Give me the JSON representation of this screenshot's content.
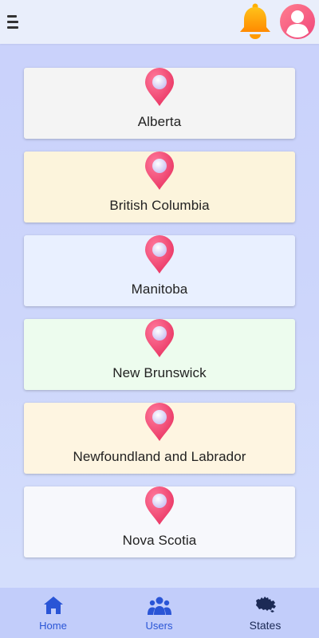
{
  "colors": {
    "pin": "#f0467a",
    "accent": "#2a55d6",
    "card_backgrounds": [
      "#f4f4f4",
      "#fcf4dc",
      "#e9f0ff",
      "#edfcee",
      "#fef5e1",
      "#f7f8fc"
    ]
  },
  "header": {
    "menu_icon": "hamburger-menu-icon",
    "notification_icon": "bell-icon",
    "profile_icon": "user-avatar-icon"
  },
  "provinces": [
    {
      "name": "Alberta"
    },
    {
      "name": "British Columbia"
    },
    {
      "name": "Manitoba"
    },
    {
      "name": "New Brunswick"
    },
    {
      "name": "Newfoundland and Labrador"
    },
    {
      "name": "Nova Scotia"
    }
  ],
  "bottom_nav": {
    "items": [
      {
        "label": "Home",
        "icon": "home-icon"
      },
      {
        "label": "Users",
        "icon": "users-icon"
      },
      {
        "label": "States",
        "icon": "canada-map-icon",
        "active": true
      }
    ]
  }
}
